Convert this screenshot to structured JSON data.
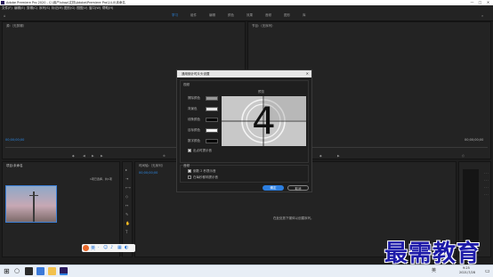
{
  "window": {
    "title": "Adobe Premiere Pro 2020 - C:\\用户\\shop\\文档\\Adobe\\Premiere Pro\\14.0\\未命名",
    "controls": [
      "—",
      "□",
      "✕"
    ]
  },
  "menu": [
    "文件(F)",
    "编辑(E)",
    "剪辑(C)",
    "序列(S)",
    "标记(M)",
    "图形(G)",
    "视图(V)",
    "窗口(W)",
    "帮助(H)"
  ],
  "workspace_tabs": [
    {
      "label": "学习",
      "active": true
    },
    {
      "label": "组件",
      "active": false
    },
    {
      "label": "编辑",
      "active": false
    },
    {
      "label": "颜色",
      "active": false
    },
    {
      "label": "效果",
      "active": false
    },
    {
      "label": "音频",
      "active": false
    },
    {
      "label": "图形",
      "active": false
    },
    {
      "label": "库",
      "active": false
    }
  ],
  "source_panel": {
    "tab": "源:（无剪辑）",
    "timecode_left": "00;00;00;00",
    "timecode_right": "00;00;00;00"
  },
  "program_panel": {
    "tab": "节目:（无序列）",
    "timecode_left": "00;00;00;00",
    "timecode_right": "00;00;00;00"
  },
  "project_panel": {
    "tab": "项目:未命名",
    "status": "1项已选择，共1项",
    "clip_name": "",
    "clip_duration": ""
  },
  "timeline_panel": {
    "tab": "时间轴:（无序列）",
    "timecode": "00;00;00;00",
    "hint": "在此处放下媒体以创建序列。"
  },
  "dialog": {
    "title": "通用倒计时片头设置",
    "video_section": "视频",
    "preview_label": "预览",
    "fields": [
      {
        "label": "擦除颜色",
        "color": "#9a9a9a"
      },
      {
        "label": "背景色",
        "color": "#e4e4e4"
      },
      {
        "label": "线条颜色",
        "color": "#050505"
      },
      {
        "label": "目标颜色",
        "color": "#f4f4f4"
      },
      {
        "label": "数字颜色",
        "color": "#050505"
      }
    ],
    "flash_checkbox": {
      "label": "出点时提示音",
      "checked": true
    },
    "audio_section": "音频",
    "audio_options": [
      {
        "label": "倒数 2 秒提示音",
        "checked": true
      },
      {
        "label": "在每秒都响提示音",
        "checked": false
      }
    ],
    "preview_number": "4",
    "ok_label": "确定",
    "cancel_label": "取消"
  },
  "taskbar": {
    "time": "9:25",
    "date": "2021/7/28",
    "tray_text": "英"
  },
  "watermark": "最需教育"
}
